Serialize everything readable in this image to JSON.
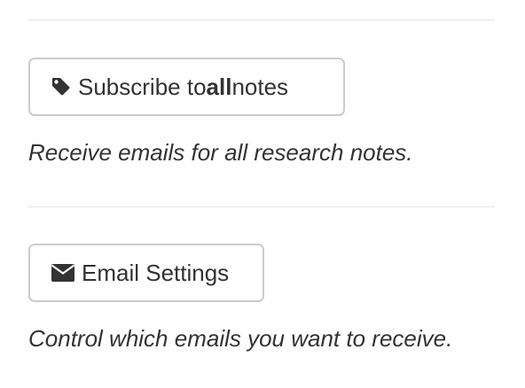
{
  "subscribe": {
    "label_prefix": "Subscribe to ",
    "label_bold": "all",
    "label_suffix": " notes",
    "icon": "tag-icon",
    "description": "Receive emails for all research notes."
  },
  "email_settings": {
    "label": "Email Settings",
    "icon": "envelope-icon",
    "description": "Control which emails you want to receive."
  },
  "colors": {
    "text": "#333333",
    "border": "#cccccc",
    "divider": "#e5e5e5"
  }
}
